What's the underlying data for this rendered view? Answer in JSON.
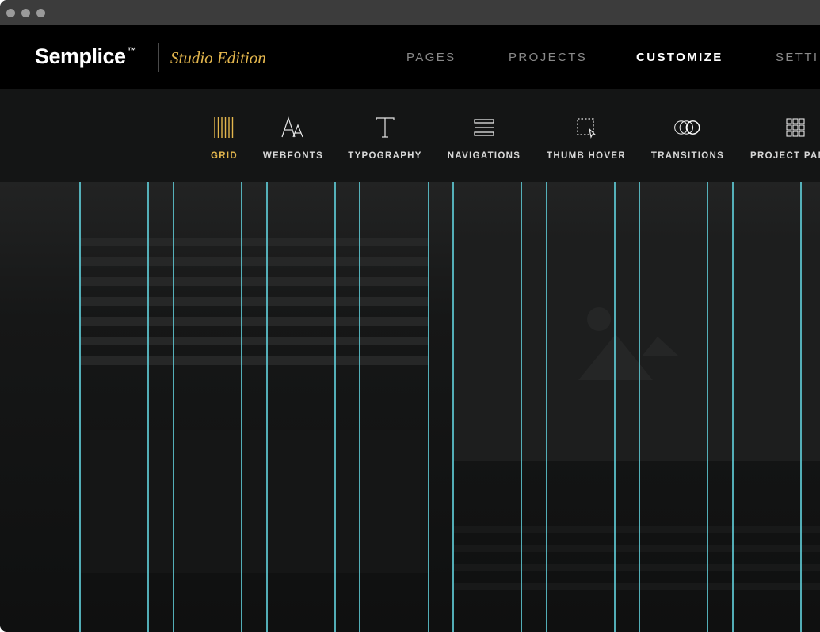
{
  "app": {
    "brand": "Semplice",
    "trademark": "™",
    "edition": "Studio Edition"
  },
  "nav": {
    "items": [
      {
        "label": "PAGES",
        "active": false
      },
      {
        "label": "PROJECTS",
        "active": false
      },
      {
        "label": "CUSTOMIZE",
        "active": true
      },
      {
        "label": "SETTI",
        "active": false
      }
    ]
  },
  "toolbar": {
    "items": [
      {
        "label": "GRID",
        "icon": "grid-icon",
        "active": true
      },
      {
        "label": "WEBFONTS",
        "icon": "webfonts-icon",
        "active": false
      },
      {
        "label": "TYPOGRAPHY",
        "icon": "typography-icon",
        "active": false
      },
      {
        "label": "NAVIGATIONS",
        "icon": "navigations-icon",
        "active": false
      },
      {
        "label": "THUMB HOVER",
        "icon": "thumb-hover-icon",
        "active": false
      },
      {
        "label": "TRANSITIONS",
        "icon": "transitions-icon",
        "active": false
      },
      {
        "label": "PROJECT PAN",
        "icon": "project-panel-icon",
        "active": false
      }
    ]
  },
  "colors": {
    "accent": "#e3b64d",
    "grid_line": "#5ec9d3",
    "nav_background": "#000000",
    "toolbar_background": "#141515"
  }
}
